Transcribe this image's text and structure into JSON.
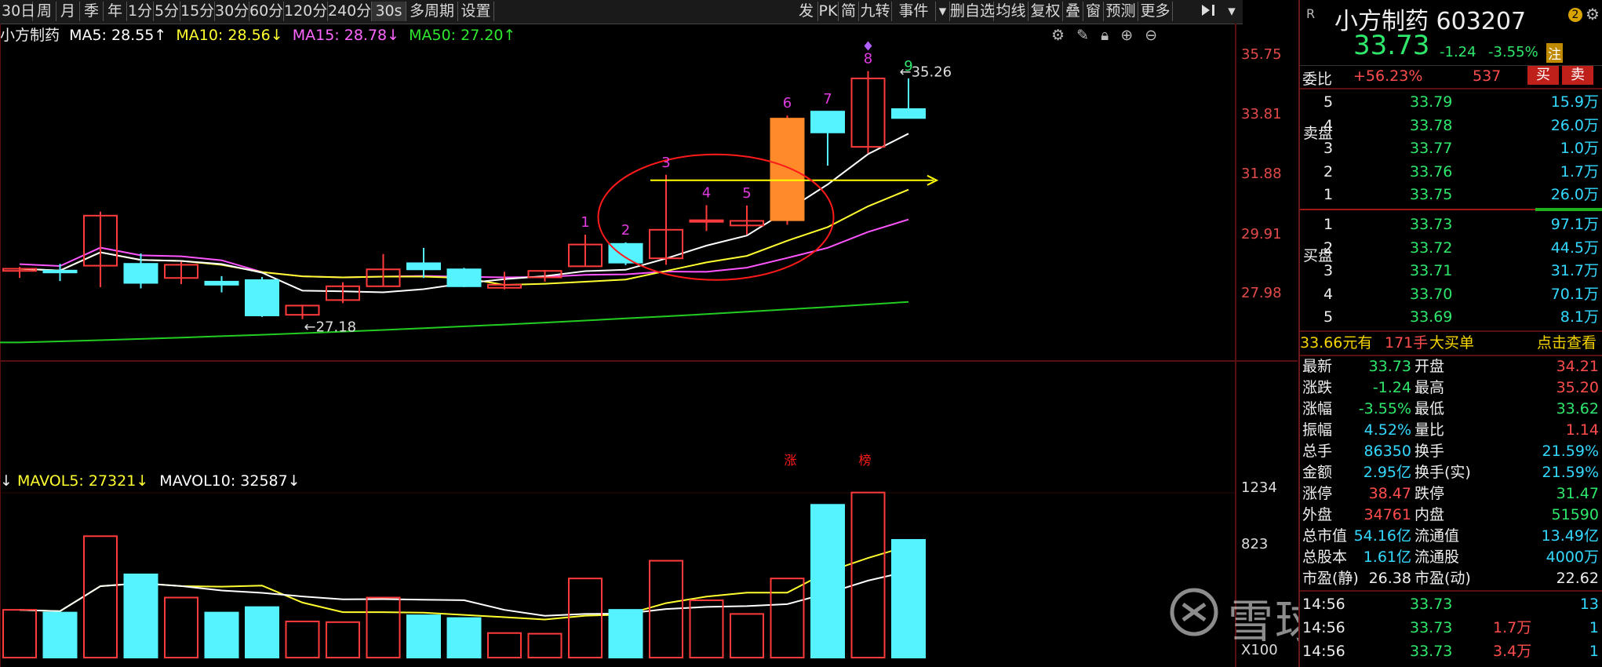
{
  "toolbar": {
    "left": [
      "30日",
      "周",
      "月",
      "季",
      "年",
      "1分",
      "5分",
      "15分",
      "30分",
      "60分",
      "120分",
      "240分",
      "30s",
      "多周期",
      "设置"
    ],
    "right": [
      "发",
      "PK",
      "简",
      "九转",
      "事件",
      "删自选",
      "均线",
      "复权",
      "叠",
      "窗",
      "预测",
      "更多"
    ]
  },
  "legend": {
    "name": "小方制药",
    "ma5": "MA5: 28.55↑",
    "ma10": "MA10: 28.56↓",
    "ma15": "MA15: 28.78↓",
    "ma50": "MA50: 27.20↑"
  },
  "vollegend": {
    "arrow": "↓",
    "mavol5": "MAVOL5: 27321↓",
    "mavol10": "MAVOL10: 32587↓"
  },
  "colors": {
    "up": "#ff3b3b",
    "down": "#54f3ff",
    "ma5": "#ffffff",
    "ma10": "#ffff30",
    "ma15": "#ff55ff",
    "ma50": "#22cc22",
    "annot": "#ff1a1a",
    "level": "#ffff00",
    "seq": "#e23be2"
  },
  "chart_data": {
    "type": "candlestick",
    "price_axis": {
      "ticks": [
        "35.75",
        "33.81",
        "31.88",
        "29.91",
        "27.98"
      ],
      "values": [
        35.75,
        33.81,
        31.88,
        29.91,
        27.98
      ],
      "ylim": [
        26.2,
        36.5
      ]
    },
    "volume_axis": {
      "ticks": [
        "1234",
        "823"
      ],
      "values": [
        1234,
        823
      ],
      "unit_label": "X100",
      "ylim": [
        0,
        1300
      ]
    },
    "candles": [
      {
        "o": 28.75,
        "h": 28.88,
        "l": 28.52,
        "c": 28.82,
        "v": 350
      },
      {
        "o": 28.76,
        "h": 28.98,
        "l": 28.42,
        "c": 28.7,
        "v": 330
      },
      {
        "o": 28.92,
        "h": 30.68,
        "l": 28.22,
        "c": 30.55,
        "v": 890
      },
      {
        "o": 28.98,
        "h": 29.32,
        "l": 28.18,
        "c": 28.36,
        "v": 610
      },
      {
        "o": 28.52,
        "h": 29.05,
        "l": 28.32,
        "c": 28.95,
        "v": 440
      },
      {
        "o": 28.4,
        "h": 28.58,
        "l": 28.05,
        "c": 28.3,
        "v": 330
      },
      {
        "o": 28.45,
        "h": 28.55,
        "l": 27.25,
        "c": 27.3,
        "v": 370
      },
      {
        "o": 27.32,
        "h": 27.65,
        "l": 27.18,
        "c": 27.62,
        "v": 265
      },
      {
        "o": 27.8,
        "h": 28.38,
        "l": 27.7,
        "c": 28.25,
        "v": 260
      },
      {
        "o": 28.25,
        "h": 29.3,
        "l": 28.25,
        "c": 28.8,
        "v": 440
      },
      {
        "o": 29.0,
        "h": 29.5,
        "l": 28.52,
        "c": 28.8,
        "v": 310
      },
      {
        "o": 28.8,
        "h": 28.85,
        "l": 28.22,
        "c": 28.25,
        "v": 290
      },
      {
        "o": 28.2,
        "h": 28.72,
        "l": 28.15,
        "c": 28.3,
        "v": 180
      },
      {
        "o": 28.54,
        "h": 28.78,
        "l": 28.4,
        "c": 28.75,
        "v": 175
      },
      {
        "o": 28.9,
        "h": 29.93,
        "l": 28.9,
        "c": 29.61,
        "v": 580
      },
      {
        "o": 29.63,
        "h": 29.68,
        "l": 28.94,
        "c": 29.02,
        "v": 350
      },
      {
        "o": 29.16,
        "h": 31.88,
        "l": 28.95,
        "c": 30.09,
        "v": 710
      },
      {
        "o": 30.38,
        "h": 30.89,
        "l": 30.05,
        "c": 30.4,
        "v": 420
      },
      {
        "o": 30.23,
        "h": 30.88,
        "l": 29.93,
        "c": 30.38,
        "v": 320
      },
      {
        "o": 30.4,
        "h": 33.81,
        "l": 30.25,
        "c": 33.71,
        "v": 580
      },
      {
        "o": 33.94,
        "h": 33.94,
        "l": 32.18,
        "c": 33.26,
        "v": 1120
      },
      {
        "o": 32.79,
        "h": 35.26,
        "l": 32.58,
        "c": 35.02,
        "v": 1210
      },
      {
        "o": 34.02,
        "h": 35.02,
        "l": 33.82,
        "c": 33.73,
        "v": 863
      }
    ],
    "labels": {
      "high_label": "35.26",
      "low_label": "27.18",
      "seq": [
        "1",
        "2",
        "3",
        "4",
        "5",
        "6",
        "7",
        "8",
        "9"
      ],
      "zhang": "涨",
      "bang": "榜"
    }
  },
  "panel": {
    "title": "小方制药 603207",
    "price": "33.73",
    "change": "-1.24",
    "pct": "-3.55%",
    "zhu": "注",
    "weibi_label": "委比",
    "weibi": "+56.23%",
    "weicha": "537",
    "buy_btn": "买",
    "sell_btn": "卖",
    "sell_label": "卖盘",
    "buy_label": "买盘",
    "asks": [
      {
        "n": "5",
        "p": "33.79",
        "v": "15.9万"
      },
      {
        "n": "4",
        "p": "33.78",
        "v": "26.0万"
      },
      {
        "n": "3",
        "p": "33.77",
        "v": "1.0万"
      },
      {
        "n": "2",
        "p": "33.76",
        "v": "1.7万"
      },
      {
        "n": "1",
        "p": "33.75",
        "v": "26.0万"
      }
    ],
    "bids": [
      {
        "n": "1",
        "p": "33.73",
        "v": "97.1万"
      },
      {
        "n": "2",
        "p": "33.72",
        "v": "44.5万"
      },
      {
        "n": "3",
        "p": "33.71",
        "v": "31.7万"
      },
      {
        "n": "4",
        "p": "33.70",
        "v": "70.1万"
      },
      {
        "n": "5",
        "p": "33.69",
        "v": "8.1万"
      }
    ],
    "bigorder": {
      "a": "33.66元有",
      "b": "171手",
      "c": "大买单",
      "d": "点击查看"
    },
    "stats": [
      {
        "k1": "最新",
        "v1": "33.73",
        "k2": "开盘",
        "v2": "34.21",
        "c1": "green",
        "c2": "red"
      },
      {
        "k1": "涨跌",
        "v1": "-1.24",
        "k2": "最高",
        "v2": "35.20",
        "c1": "green",
        "c2": "red"
      },
      {
        "k1": "涨幅",
        "v1": "-3.55%",
        "k2": "最低",
        "v2": "33.62",
        "c1": "green",
        "c2": "green"
      },
      {
        "k1": "振幅",
        "v1": "4.52%",
        "k2": "量比",
        "v2": "1.14",
        "c1": "cyan",
        "c2": "red"
      },
      {
        "k1": "总手",
        "v1": "86350",
        "k2": "换手",
        "v2": "21.59%",
        "c1": "cyan",
        "c2": "cyan"
      },
      {
        "k1": "金额",
        "v1": "2.95亿",
        "k2": "换手(实)",
        "v2": "21.59%",
        "c1": "cyan",
        "c2": "cyan"
      },
      {
        "k1": "涨停",
        "v1": "38.47",
        "k2": "跌停",
        "v2": "31.47",
        "c1": "red",
        "c2": "green"
      },
      {
        "k1": "外盘",
        "v1": "34761",
        "k2": "内盘",
        "v2": "51590",
        "c1": "red",
        "c2": "green"
      },
      {
        "k1": "总市值",
        "v1": "54.16亿",
        "k2": "流通值",
        "v2": "13.49亿",
        "c1": "cyan",
        "c2": "cyan"
      },
      {
        "k1": "总股本",
        "v1": "1.61亿",
        "k2": "流通股",
        "v2": "4000万",
        "c1": "cyan",
        "c2": "cyan"
      },
      {
        "k1": "市盈(静)",
        "v1": "26.38",
        "k2": "市盈(动)",
        "v2": "22.62",
        "c1": "white",
        "c2": "white"
      }
    ],
    "ticks": [
      {
        "t": "14:56",
        "p": "33.73",
        "v": "",
        "n": "13"
      },
      {
        "t": "14:56",
        "p": "33.73",
        "v": "1.7万",
        "n": "1"
      },
      {
        "t": "14:56",
        "p": "33.73",
        "v": "3.4万",
        "n": "1"
      }
    ]
  },
  "watermark": "雪球：侠股新秀"
}
